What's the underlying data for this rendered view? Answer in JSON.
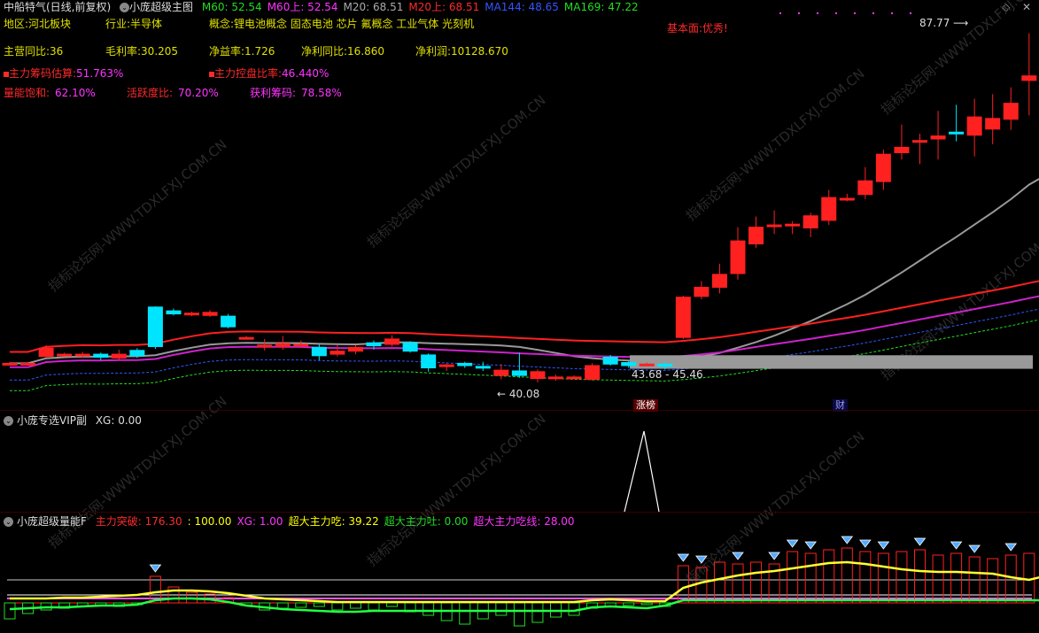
{
  "header": {
    "title": "中船特气(日线,前复权)",
    "indicator_name": "小庞超级主图",
    "ma_items": [
      {
        "label": "M60: 52.54",
        "color": "#22dd22"
      },
      {
        "label": "M60上: 52.54",
        "color": "#ff33ff"
      },
      {
        "label": "M20: 68.51",
        "color": "#aaaaaa"
      },
      {
        "label": "M20上: 68.51",
        "color": "#ff2a2a"
      },
      {
        "label": "MA144: 48.65",
        "color": "#3355ff"
      },
      {
        "label": "MA169: 47.22",
        "color": "#22dd22"
      }
    ]
  },
  "info": {
    "region_label": "地区:",
    "region_value": "河北板块",
    "industry_label": "行业:",
    "industry_value": "半导体",
    "concept_label": "概念:",
    "concept_value": "锂电池概念 固态电池 芯片 氟概念 工业气体 光刻机",
    "fundamental": "基本面:优秀!",
    "rev_yoy_label": "主营同比:",
    "rev_yoy_value": "36",
    "gross_margin_label": "毛利率:",
    "gross_margin_value": "30.205",
    "net_margin_label": "净益率:",
    "net_margin_value": "1.726",
    "profit_yoy_label": "净利同比:",
    "profit_yoy_value": "16.860",
    "net_profit_label": "净利润:",
    "net_profit_value": "10128.670",
    "chip_est_label": "主力筹码估算:",
    "chip_est_value": "51.763%",
    "control_label": "主力控盘比率:",
    "control_value": "46.440%",
    "vol_sat_label": "量能饱和:",
    "vol_sat_value": "62.10%",
    "activity_label": "活跃度比:",
    "activity_value": "70.20%",
    "profit_chip_label": "获利筹码:",
    "profit_chip_value": "78.58%"
  },
  "annotations": {
    "high": "87.77",
    "low": "40.08",
    "zone": "43.68 - 45.46",
    "limit_up": "涨榜",
    "fin": "财",
    "watermark": "指标论坛网-WWW.TDXLFXJ.COM.CN"
  },
  "panel2": {
    "title": "小庞专选VIP副",
    "xg": "XG: 0.00"
  },
  "panel3": {
    "title": "小庞超级量能F",
    "items": [
      {
        "label": "主力突破: 176.30",
        "color": "#ff2a2a"
      },
      {
        "label": ": 100.00",
        "color": "#ffff00"
      },
      {
        "label": "XG: 1.00",
        "color": "#ff33ff"
      },
      {
        "label": "超大主力吃: 39.22",
        "color": "#ffff00"
      },
      {
        "label": "超大主力吐: 0.00",
        "color": "#22dd22"
      },
      {
        "label": "超大主力吃线: 28.00",
        "color": "#ff33ff"
      }
    ]
  },
  "chart_data": {
    "type": "candlestick",
    "ylim": [
      38,
      90
    ],
    "candles": [
      [
        44.2,
        44.4,
        44.6,
        44.1
      ],
      [
        44.3,
        44.4,
        44.6,
        44.1
      ],
      [
        45.3,
        46.4,
        46.8,
        45.1
      ],
      [
        45.6,
        45.6,
        45.8,
        45.4
      ],
      [
        45.4,
        45.6,
        45.9,
        45.2
      ],
      [
        45.6,
        45.2,
        45.8,
        44.8
      ],
      [
        45.1,
        45.6,
        46.2,
        44.8
      ],
      [
        46.1,
        45.4,
        46.4,
        45.1
      ],
      [
        51.8,
        46.6,
        51.9,
        46.3
      ],
      [
        51.3,
        50.9,
        51.6,
        50.7
      ],
      [
        50.8,
        51.0,
        51.2,
        50.6
      ],
      [
        50.7,
        51.1,
        51.4,
        50.5
      ],
      [
        50.6,
        49.2,
        50.9,
        49.0
      ],
      [
        47.8,
        47.8,
        48.0,
        47.6
      ],
      [
        46.7,
        46.8,
        47.6,
        46.1
      ],
      [
        46.6,
        47.0,
        48.0,
        46.2
      ],
      [
        46.9,
        46.9,
        47.4,
        46.6
      ],
      [
        46.5,
        45.4,
        46.9,
        44.8
      ],
      [
        45.6,
        46.0,
        46.8,
        45.3
      ],
      [
        46.0,
        46.5,
        46.8,
        45.6
      ],
      [
        47.1,
        46.7,
        47.4,
        46.2
      ],
      [
        46.9,
        47.6,
        48.1,
        46.6
      ],
      [
        47.1,
        46.0,
        47.3,
        45.8
      ],
      [
        45.5,
        43.8,
        45.7,
        43.3
      ],
      [
        44.0,
        44.2,
        44.4,
        43.4
      ],
      [
        44.4,
        44.1,
        44.6,
        43.8
      ],
      [
        44.0,
        43.8,
        44.6,
        43.4
      ],
      [
        42.8,
        43.5,
        44.3,
        42.3
      ],
      [
        43.4,
        42.8,
        45.8,
        42.5
      ],
      [
        42.4,
        43.3,
        43.6,
        41.9
      ],
      [
        42.4,
        42.6,
        42.9,
        42.1
      ],
      [
        42.6,
        42.6,
        42.8,
        42.4
      ],
      [
        42.3,
        44.1,
        44.4,
        42.1
      ],
      [
        45.2,
        44.3,
        45.5,
        44.1
      ],
      [
        44.5,
        44.1,
        44.8,
        43.8
      ],
      [
        44.3,
        44.3,
        44.5,
        44.1
      ],
      [
        44.3,
        44.0,
        44.5,
        43.6
      ],
      [
        47.8,
        53.1,
        53.3,
        47.6
      ],
      [
        53.2,
        54.4,
        55.2,
        52.8
      ],
      [
        54.4,
        56.1,
        57.5,
        53.6
      ],
      [
        56.2,
        60.5,
        62.3,
        55.4
      ],
      [
        60.1,
        62.3,
        63.7,
        59.6
      ],
      [
        62.4,
        62.6,
        64.5,
        61.4
      ],
      [
        62.6,
        62.7,
        63.1,
        61.4
      ],
      [
        62.2,
        63.8,
        64.2,
        61.0
      ],
      [
        63.2,
        66.2,
        67.2,
        62.6
      ],
      [
        66.0,
        66.1,
        66.7,
        65.7
      ],
      [
        66.6,
        68.4,
        70.2,
        66.0
      ],
      [
        68.3,
        71.9,
        72.5,
        67.2
      ],
      [
        72.1,
        72.8,
        75.8,
        71.2
      ],
      [
        73.5,
        73.7,
        74.6,
        70.6
      ],
      [
        73.9,
        74.3,
        77.6,
        71.2
      ],
      [
        74.8,
        74.7,
        78.4,
        73.6
      ],
      [
        74.4,
        76.8,
        79.2,
        71.6
      ],
      [
        75.2,
        76.6,
        79.8,
        73.2
      ],
      [
        76.5,
        78.6,
        80.7,
        75.1
      ],
      [
        81.6,
        82.2,
        87.8,
        77.0
      ],
      [
        84.6,
        80.6,
        85.3,
        79.1
      ],
      [
        80.2,
        81.8,
        84.3,
        79.8
      ],
      [
        83.1,
        80.7,
        84.1,
        79.6
      ]
    ]
  }
}
